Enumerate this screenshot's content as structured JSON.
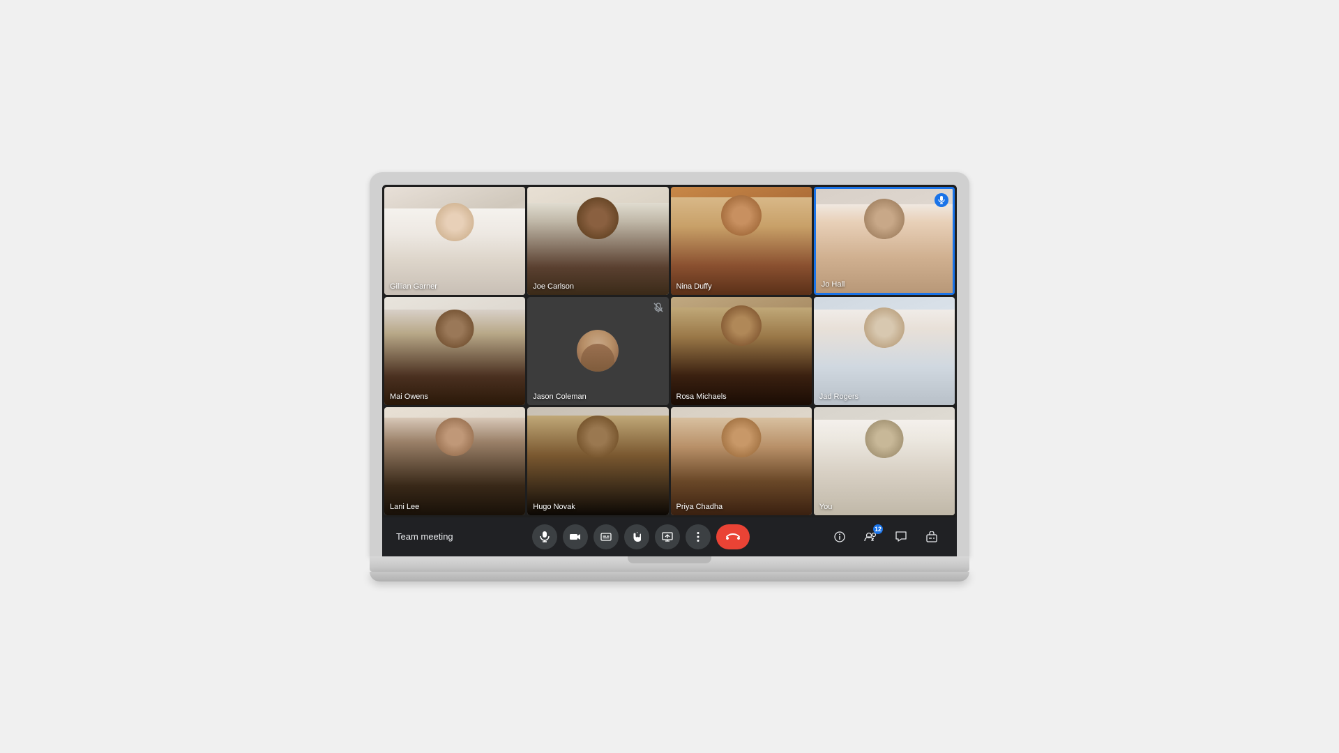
{
  "meeting": {
    "title": "Team meeting",
    "participants": [
      {
        "id": "p1",
        "name": "Gillian Garner",
        "muted": false,
        "active": false,
        "cam_on": true,
        "color_class": "p1"
      },
      {
        "id": "p2",
        "name": "Joe Carlson",
        "muted": false,
        "active": false,
        "cam_on": true,
        "color_class": "p2"
      },
      {
        "id": "p3",
        "name": "Nina Duffy",
        "muted": false,
        "active": false,
        "cam_on": true,
        "color_class": "p3"
      },
      {
        "id": "p4",
        "name": "Jo Hall",
        "muted": false,
        "active": true,
        "cam_on": true,
        "color_class": "p4",
        "mic_active": true
      },
      {
        "id": "p5",
        "name": "Mai Owens",
        "muted": false,
        "active": false,
        "cam_on": true,
        "color_class": "p5"
      },
      {
        "id": "p6",
        "name": "Jason Coleman",
        "muted": true,
        "active": false,
        "cam_on": false,
        "color_class": "p6"
      },
      {
        "id": "p7",
        "name": "Rosa Michaels",
        "muted": false,
        "active": false,
        "cam_on": true,
        "color_class": "p7"
      },
      {
        "id": "p8",
        "name": "Jad Rogers",
        "muted": false,
        "active": false,
        "cam_on": true,
        "color_class": "p8"
      },
      {
        "id": "p9",
        "name": "Lani Lee",
        "muted": false,
        "active": false,
        "cam_on": true,
        "color_class": "p9"
      },
      {
        "id": "p10",
        "name": "Hugo Novak",
        "muted": false,
        "active": false,
        "cam_on": true,
        "color_class": "p10"
      },
      {
        "id": "p11",
        "name": "Priya Chadha",
        "muted": false,
        "active": false,
        "cam_on": true,
        "color_class": "p11"
      },
      {
        "id": "p12",
        "name": "You",
        "muted": false,
        "active": false,
        "cam_on": true,
        "color_class": "p12"
      }
    ],
    "participant_count": "12",
    "toolbar": {
      "mic_label": "Microphone",
      "cam_label": "Camera",
      "captions_label": "Captions",
      "hand_label": "Raise hand",
      "present_label": "Present now",
      "more_label": "More options",
      "end_call_label": "Leave call",
      "info_label": "Meeting details",
      "people_label": "People",
      "chat_label": "Chat",
      "activities_label": "Activities"
    }
  }
}
